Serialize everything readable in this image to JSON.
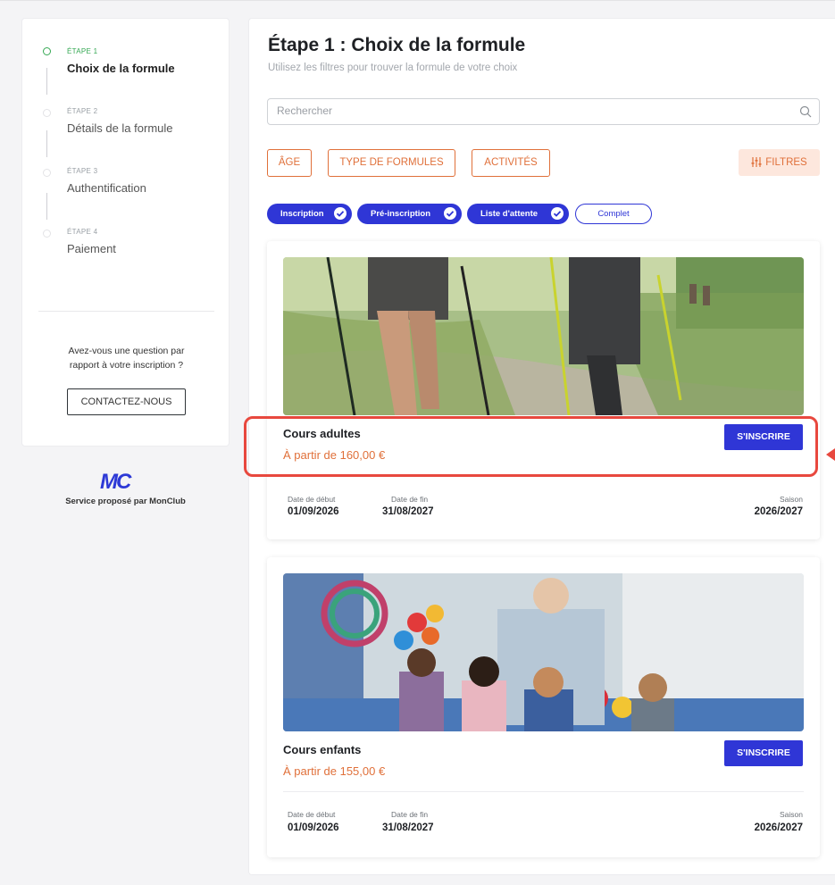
{
  "steps": [
    {
      "label": "ÉTAPE 1",
      "title": "Choix de la formule",
      "active": true
    },
    {
      "label": "ÉTAPE 2",
      "title": "Détails de la formule",
      "active": false
    },
    {
      "label": "ÉTAPE 3",
      "title": "Authentification",
      "active": false
    },
    {
      "label": "ÉTAPE 4",
      "title": "Paiement",
      "active": false
    }
  ],
  "sidebar": {
    "question": "Avez-vous une question par rapport à votre inscription ?",
    "contact_label": "CONTACTEZ-NOUS",
    "logo_text": "MC",
    "service_text": "Service proposé par MonClub"
  },
  "main": {
    "title": "Étape 1 : Choix de la formule",
    "subtitle": "Utilisez les filtres pour trouver la formule de votre choix"
  },
  "search": {
    "placeholder": "Rechercher",
    "value": ""
  },
  "filters": {
    "age": "ÂGE",
    "type": "TYPE DE FORMULES",
    "activities": "ACTIVITÉS",
    "filtres": "FILTRES"
  },
  "chips": [
    {
      "label": "Inscription",
      "selected": true
    },
    {
      "label": "Pré-inscription",
      "selected": true
    },
    {
      "label": "Liste d'attente",
      "selected": true
    },
    {
      "label": "Complet",
      "selected": false
    }
  ],
  "cards": [
    {
      "name": "Cours adultes",
      "price": "À partir de 160,00 €",
      "button": "S'INSCRIRE",
      "start_label": "Date de début",
      "start": "01/09/2026",
      "end_label": "Date de fin",
      "end": "31/08/2027",
      "season_label": "Saison",
      "season": "2026/2027"
    },
    {
      "name": "Cours enfants",
      "price": "À partir de 155,00 €",
      "button": "S'INSCRIRE",
      "start_label": "Date de début",
      "start": "01/09/2026",
      "end_label": "Date de fin",
      "end": "31/08/2027",
      "season_label": "Saison",
      "season": "2026/2027"
    }
  ],
  "colors": {
    "accent_blue": "#2f36d6",
    "accent_orange": "#e0703a",
    "step_active": "#35a853",
    "highlight": "#e8483e"
  }
}
